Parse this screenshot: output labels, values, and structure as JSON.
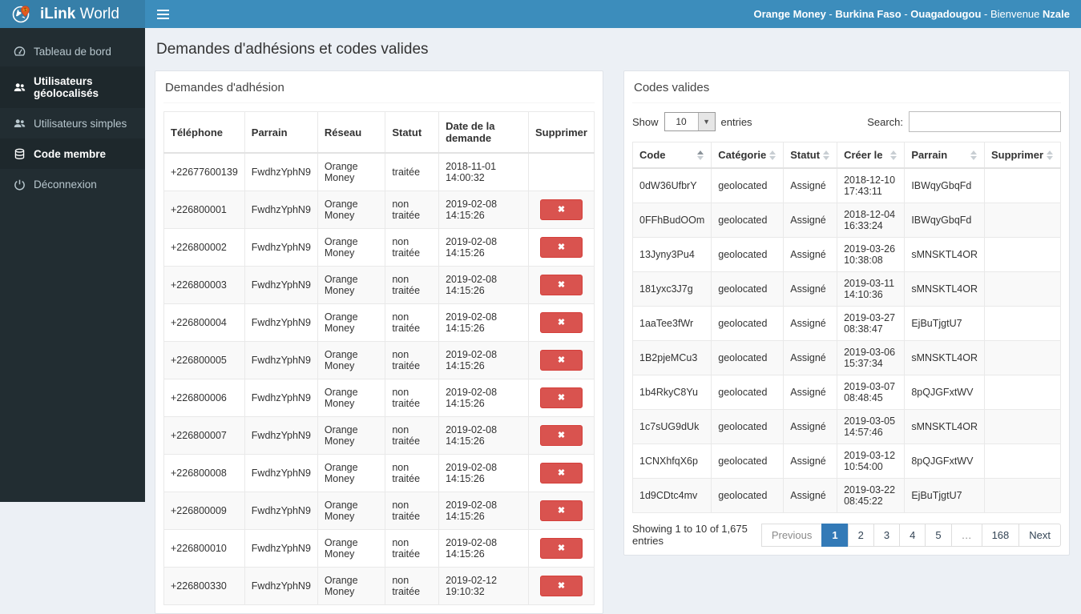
{
  "colors": {
    "accent": "#3c8dbc",
    "logo_bg": "#367fa9",
    "sidebar_bg": "#222d32",
    "sidebar_active_bg": "#1e282c",
    "content_bg": "#ecf0f5",
    "danger": "#d9534f",
    "pagination_active": "#337ab7"
  },
  "header": {
    "brand_bold": "iLink",
    "brand_rest": " World",
    "user_info": [
      {
        "text": "Orange Money",
        "bold": true,
        "sep": " - "
      },
      {
        "text": "Burkina Faso",
        "bold": true,
        "sep": " - "
      },
      {
        "text": "Ouagadougou",
        "bold": true,
        "sep": " - "
      },
      {
        "text": "Bienvenue",
        "bold": false,
        "sep": " "
      },
      {
        "text": "Nzale",
        "bold": true,
        "sep": ""
      }
    ]
  },
  "sidebar": {
    "items": [
      {
        "label": "Tableau de bord",
        "icon": "dashboard-icon",
        "active": false
      },
      {
        "label": "Utilisateurs géolocalisés",
        "icon": "users-icon",
        "active": true
      },
      {
        "label": "Utilisateurs simples",
        "icon": "users-icon",
        "active": false
      },
      {
        "label": "Code membre",
        "icon": "database-icon",
        "active": true
      },
      {
        "label": "Déconnexion",
        "icon": "power-icon",
        "active": false
      }
    ]
  },
  "page": {
    "title": "Demandes d'adhésions et codes valides"
  },
  "left_panel": {
    "title": "Demandes d'adhésion",
    "columns": [
      "Téléphone",
      "Parrain",
      "Réseau",
      "Statut",
      "Date de la demande",
      "Supprimer"
    ],
    "delete_glyph": "✖",
    "rows": [
      {
        "phone": "+22677600139",
        "parrain": "FwdhzYphN9",
        "reseau": "Orange Money",
        "statut": "traitée",
        "date": "2018-11-01 14:00:32",
        "deletable": false
      },
      {
        "phone": "+226800001",
        "parrain": "FwdhzYphN9",
        "reseau": "Orange Money",
        "statut": "non traitée",
        "date": "2019-02-08 14:15:26",
        "deletable": true
      },
      {
        "phone": "+226800002",
        "parrain": "FwdhzYphN9",
        "reseau": "Orange Money",
        "statut": "non traitée",
        "date": "2019-02-08 14:15:26",
        "deletable": true
      },
      {
        "phone": "+226800003",
        "parrain": "FwdhzYphN9",
        "reseau": "Orange Money",
        "statut": "non traitée",
        "date": "2019-02-08 14:15:26",
        "deletable": true
      },
      {
        "phone": "+226800004",
        "parrain": "FwdhzYphN9",
        "reseau": "Orange Money",
        "statut": "non traitée",
        "date": "2019-02-08 14:15:26",
        "deletable": true
      },
      {
        "phone": "+226800005",
        "parrain": "FwdhzYphN9",
        "reseau": "Orange Money",
        "statut": "non traitée",
        "date": "2019-02-08 14:15:26",
        "deletable": true
      },
      {
        "phone": "+226800006",
        "parrain": "FwdhzYphN9",
        "reseau": "Orange Money",
        "statut": "non traitée",
        "date": "2019-02-08 14:15:26",
        "deletable": true
      },
      {
        "phone": "+226800007",
        "parrain": "FwdhzYphN9",
        "reseau": "Orange Money",
        "statut": "non traitée",
        "date": "2019-02-08 14:15:26",
        "deletable": true
      },
      {
        "phone": "+226800008",
        "parrain": "FwdhzYphN9",
        "reseau": "Orange Money",
        "statut": "non traitée",
        "date": "2019-02-08 14:15:26",
        "deletable": true
      },
      {
        "phone": "+226800009",
        "parrain": "FwdhzYphN9",
        "reseau": "Orange Money",
        "statut": "non traitée",
        "date": "2019-02-08 14:15:26",
        "deletable": true
      },
      {
        "phone": "+226800010",
        "parrain": "FwdhzYphN9",
        "reseau": "Orange Money",
        "statut": "non traitée",
        "date": "2019-02-08 14:15:26",
        "deletable": true
      },
      {
        "phone": "+226800330",
        "parrain": "FwdhzYphN9",
        "reseau": "Orange Money",
        "statut": "non traitée",
        "date": "2019-02-12 19:10:32",
        "deletable": true
      }
    ]
  },
  "right_panel": {
    "title": "Codes valides",
    "show_label": "Show",
    "page_length": "10",
    "entries_label": "entries",
    "search_label": "Search:",
    "search_value": "",
    "columns": [
      {
        "label": "Code",
        "sort": "asc"
      },
      {
        "label": "Catégorie",
        "sort": "both"
      },
      {
        "label": "Statut",
        "sort": "both"
      },
      {
        "label": "Créer le",
        "sort": "both"
      },
      {
        "label": "Parrain",
        "sort": "both"
      },
      {
        "label": "Supprimer",
        "sort": "both"
      }
    ],
    "rows": [
      {
        "code": "0dW36UfbrY",
        "categorie": "geolocated",
        "statut": "Assigné",
        "creer_le": "2018-12-10 17:43:11",
        "parrain": "IBWqyGbqFd"
      },
      {
        "code": "0FFhBudOOm",
        "categorie": "geolocated",
        "statut": "Assigné",
        "creer_le": "2018-12-04 16:33:24",
        "parrain": "IBWqyGbqFd"
      },
      {
        "code": "13Jyny3Pu4",
        "categorie": "geolocated",
        "statut": "Assigné",
        "creer_le": "2019-03-26 10:38:08",
        "parrain": "sMNSKTL4OR"
      },
      {
        "code": "181yxc3J7g",
        "categorie": "geolocated",
        "statut": "Assigné",
        "creer_le": "2019-03-11 14:10:36",
        "parrain": "sMNSKTL4OR"
      },
      {
        "code": "1aaTee3fWr",
        "categorie": "geolocated",
        "statut": "Assigné",
        "creer_le": "2019-03-27 08:38:47",
        "parrain": "EjBuTjgtU7"
      },
      {
        "code": "1B2pjeMCu3",
        "categorie": "geolocated",
        "statut": "Assigné",
        "creer_le": "2019-03-06 15:37:34",
        "parrain": "sMNSKTL4OR"
      },
      {
        "code": "1b4RkyC8Yu",
        "categorie": "geolocated",
        "statut": "Assigné",
        "creer_le": "2019-03-07 08:48:45",
        "parrain": "8pQJGFxtWV"
      },
      {
        "code": "1c7sUG9dUk",
        "categorie": "geolocated",
        "statut": "Assigné",
        "creer_le": "2019-03-05 14:57:46",
        "parrain": "sMNSKTL4OR"
      },
      {
        "code": "1CNXhfqX6p",
        "categorie": "geolocated",
        "statut": "Assigné",
        "creer_le": "2019-03-12 10:54:00",
        "parrain": "8pQJGFxtWV"
      },
      {
        "code": "1d9CDtc4mv",
        "categorie": "geolocated",
        "statut": "Assigné",
        "creer_le": "2019-03-22 08:45:22",
        "parrain": "EjBuTjgtU7"
      }
    ],
    "info": "Showing 1 to 10 of 1,675 entries",
    "pagination": [
      {
        "label": "Previous",
        "state": "disabled"
      },
      {
        "label": "1",
        "state": "active"
      },
      {
        "label": "2",
        "state": ""
      },
      {
        "label": "3",
        "state": ""
      },
      {
        "label": "4",
        "state": ""
      },
      {
        "label": "5",
        "state": ""
      },
      {
        "label": "…",
        "state": "disabled"
      },
      {
        "label": "168",
        "state": ""
      },
      {
        "label": "Next",
        "state": ""
      }
    ]
  }
}
